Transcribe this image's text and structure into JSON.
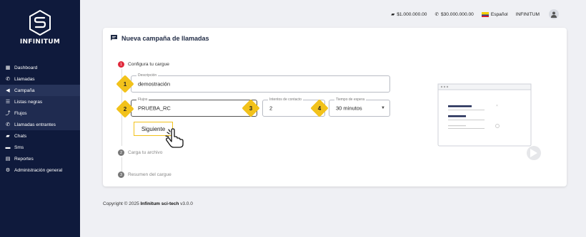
{
  "brand": {
    "name": "INFINITUM"
  },
  "sidebar": {
    "items": [
      {
        "label": "Dashboard",
        "icon": "dashboard-icon"
      },
      {
        "label": "Llamadas",
        "icon": "phone-icon"
      },
      {
        "label": "Campaña",
        "icon": "megaphone-icon"
      },
      {
        "label": "Listas negras",
        "icon": "list-icon"
      },
      {
        "label": "Flujos",
        "icon": "flow-icon"
      },
      {
        "label": "Llamadas entrantes",
        "icon": "incoming-call-icon"
      },
      {
        "label": "Chats",
        "icon": "chats-icon"
      },
      {
        "label": "Sms",
        "icon": "sms-icon"
      },
      {
        "label": "Reportes",
        "icon": "report-icon"
      },
      {
        "label": "Administración general",
        "icon": "gear-icon"
      }
    ]
  },
  "topbar": {
    "balance_sms": "$1.000.000.00",
    "balance_calls": "$30.000.000.00",
    "language": "Español",
    "user": "INFINITUM"
  },
  "card": {
    "title": "Nueva campaña de llamadas",
    "steps": [
      {
        "number": "1",
        "label": "Configura tu cargue"
      },
      {
        "number": "2",
        "label": "Carga tu archivo"
      },
      {
        "number": "3",
        "label": "Resumen del cargue"
      }
    ],
    "fields": {
      "description": {
        "legend": "Descripción",
        "value": "demostración"
      },
      "flows": {
        "legend": "Flujos",
        "value": "PRUEBA_RC"
      },
      "attempts": {
        "legend": "Intentos de contacto",
        "value": "2"
      },
      "wait": {
        "legend": "Tiempo de espera",
        "value": "30 minutos"
      }
    },
    "badges": [
      "1",
      "2",
      "3",
      "4"
    ],
    "next_label": "Siguiente"
  },
  "footer": {
    "prefix": "Copyright © 2025",
    "company": "Infinitum sci-tech",
    "version": "v3.0.0"
  },
  "colors": {
    "sidebar": "#0f1a3c",
    "accent": "#f2c21b",
    "step_active": "#e0293b"
  }
}
